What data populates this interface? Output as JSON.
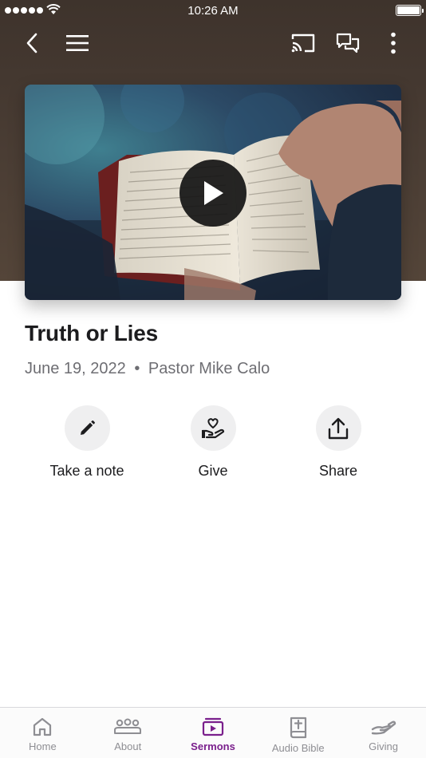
{
  "status_bar": {
    "time": "10:26 AM"
  },
  "nav": {
    "back_icon": "chevron-left-icon",
    "menu_icon": "hamburger-menu-icon",
    "cast_icon": "cast-icon",
    "chat_icon": "chat-icon",
    "more_icon": "more-vertical-icon"
  },
  "video": {
    "play_icon": "play-icon"
  },
  "sermon": {
    "title": "Truth or Lies",
    "date": "June 19, 2022",
    "separator": "•",
    "speaker": "Pastor Mike Calo"
  },
  "actions": [
    {
      "label": "Take a note",
      "icon": "pencil-icon"
    },
    {
      "label": "Give",
      "icon": "heart-hand-icon"
    },
    {
      "label": "Share",
      "icon": "share-icon"
    }
  ],
  "tabs": [
    {
      "label": "Home",
      "icon": "home-icon",
      "active": false
    },
    {
      "label": "About",
      "icon": "people-icon",
      "active": false
    },
    {
      "label": "Sermons",
      "icon": "video-icon",
      "active": true
    },
    {
      "label": "Audio Bible",
      "icon": "bible-icon",
      "active": false
    },
    {
      "label": "Giving",
      "icon": "giving-hand-icon",
      "active": false
    }
  ],
  "colors": {
    "accent": "#7a1f8c",
    "hero": "#4a3d34"
  }
}
